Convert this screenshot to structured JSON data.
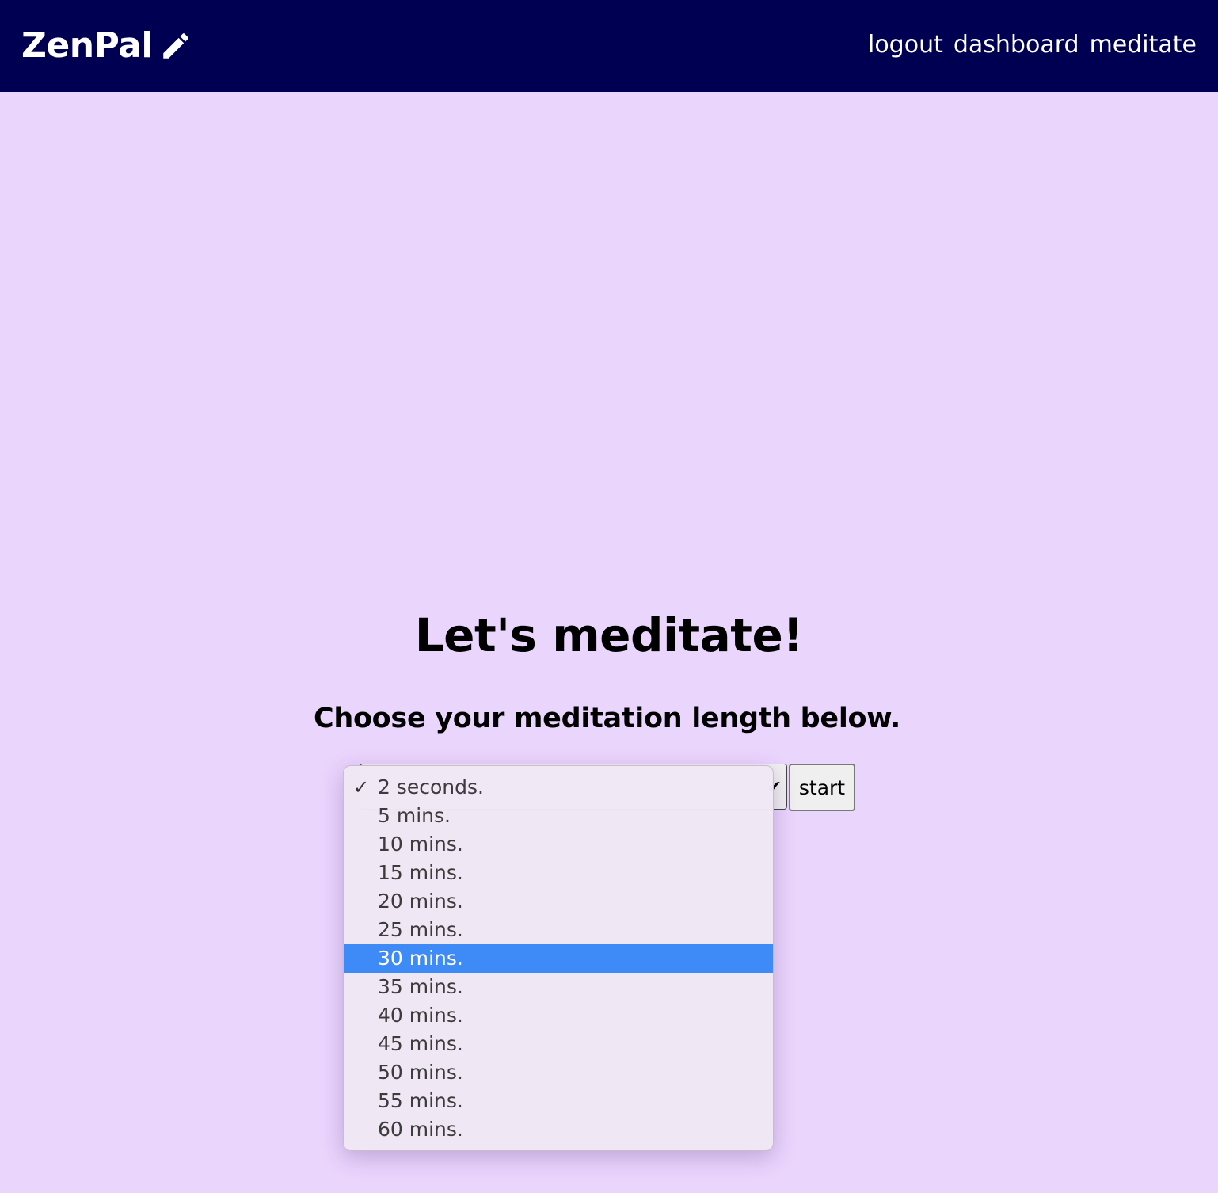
{
  "nav": {
    "brand": "ZenPal",
    "brand_icon": "pencil-icon",
    "links": [
      "logout",
      "dashboard",
      "meditate"
    ]
  },
  "main": {
    "title": "Let's meditate!",
    "subtitle": "Choose your meditation length below.",
    "start_label": "start",
    "select": {
      "selected": "2 seconds.",
      "highlighted": "30 mins.",
      "options": [
        "2 seconds.",
        "5 mins.",
        "10 mins.",
        "15 mins.",
        "20 mins.",
        "25 mins.",
        "30 mins.",
        "35 mins.",
        "40 mins.",
        "45 mins.",
        "50 mins.",
        "55 mins.",
        "60 mins."
      ]
    }
  },
  "colors": {
    "navbar": "#000052",
    "page_background": "#ead5fd",
    "highlight": "#3e8af7"
  }
}
